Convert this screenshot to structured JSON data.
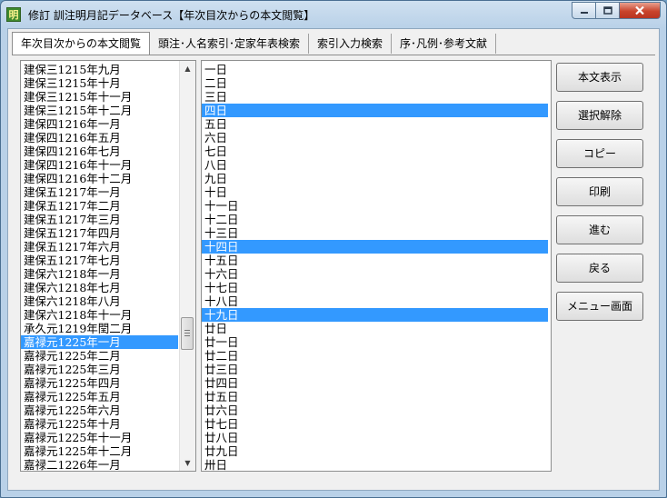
{
  "window": {
    "icon_glyph": "明",
    "title": "修訂 訓注明月記データベース【年次目次からの本文閲覧】"
  },
  "tabs": [
    {
      "label": "年次目次からの本文閲覧"
    },
    {
      "label": "頭注･人名索引･定家年表検索"
    },
    {
      "label": "索引入力検索"
    },
    {
      "label": "序･凡例･参考文献"
    }
  ],
  "months": [
    "建保三1215年九月",
    "建保三1215年十月",
    "建保三1215年十一月",
    "建保三1215年十二月",
    "建保四1216年一月",
    "建保四1216年五月",
    "建保四1216年七月",
    "建保四1216年十一月",
    "建保四1216年十二月",
    "建保五1217年一月",
    "建保五1217年二月",
    "建保五1217年三月",
    "建保五1217年四月",
    "建保五1217年六月",
    "建保五1217年七月",
    "建保六1218年一月",
    "建保六1218年七月",
    "建保六1218年八月",
    "建保六1218年十一月",
    "承久元1219年閏二月",
    "嘉禄元1225年一月",
    "嘉禄元1225年二月",
    "嘉禄元1225年三月",
    "嘉禄元1225年四月",
    "嘉禄元1225年五月",
    "嘉禄元1225年六月",
    "嘉禄元1225年十月",
    "嘉禄元1225年十一月",
    "嘉禄元1225年十二月",
    "嘉禄二1226年一月"
  ],
  "days": [
    "一日",
    "二日",
    "三日",
    "四日",
    "五日",
    "六日",
    "七日",
    "八日",
    "九日",
    "十日",
    "十一日",
    "十二日",
    "十三日",
    "十四日",
    "十五日",
    "十六日",
    "十七日",
    "十八日",
    "十九日",
    "廿日",
    "廿一日",
    "廿二日",
    "廿三日",
    "廿四日",
    "廿五日",
    "廿六日",
    "廿七日",
    "廿八日",
    "廿九日",
    "卅日"
  ],
  "selected_month_index": 20,
  "selected_day_indexes": [
    3,
    13,
    18
  ],
  "buttons": {
    "show_text": "本文表示",
    "deselect": "選択解除",
    "copy": "コピー",
    "print": "印刷",
    "forward": "進む",
    "back": "戻る",
    "menu": "メニュー画面"
  },
  "colors": {
    "selection": "#3399ff",
    "close_button": "#c9442c"
  }
}
